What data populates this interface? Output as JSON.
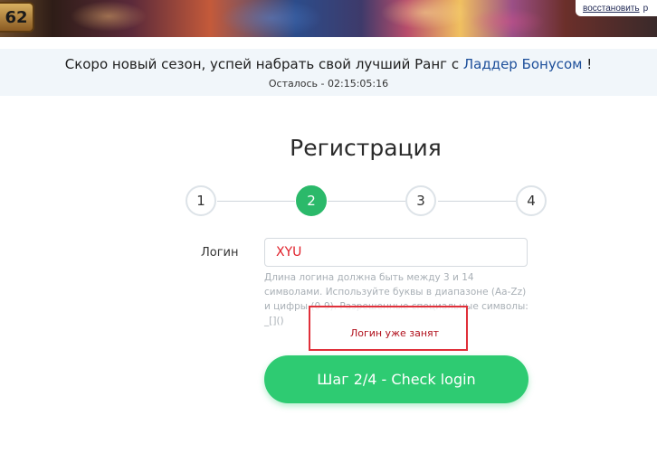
{
  "header": {
    "level_badge": "62",
    "account_link": "восстановить",
    "account_extra": "р"
  },
  "season_notice": {
    "text_before": "Скоро новый сезон, успей набрать свой лучший Ранг с ",
    "ladder_link": "Ладдер Бонусом",
    "text_after": " !",
    "timer": "Осталось - 02:15:05:16"
  },
  "registration": {
    "title": "Регистрация",
    "steps": [
      "1",
      "2",
      "3",
      "4"
    ],
    "active_step": 2,
    "login_label": "Логин",
    "login_value": "XYU",
    "login_hint": "Длина логина должна быть между 3 и 14 символами. Используйте буквы в диапазоне (Aa-Zz) и цифры (0-9). Разрешенные специальные символы: _[]()",
    "error_message": "Логин уже занят",
    "next_button": "Шаг 2/4 - Check login"
  },
  "colors": {
    "accent_green": "#2ecb72",
    "error_red": "#e0303a",
    "link_blue": "#1d4f9a",
    "input_text_red": "#e0202a"
  }
}
